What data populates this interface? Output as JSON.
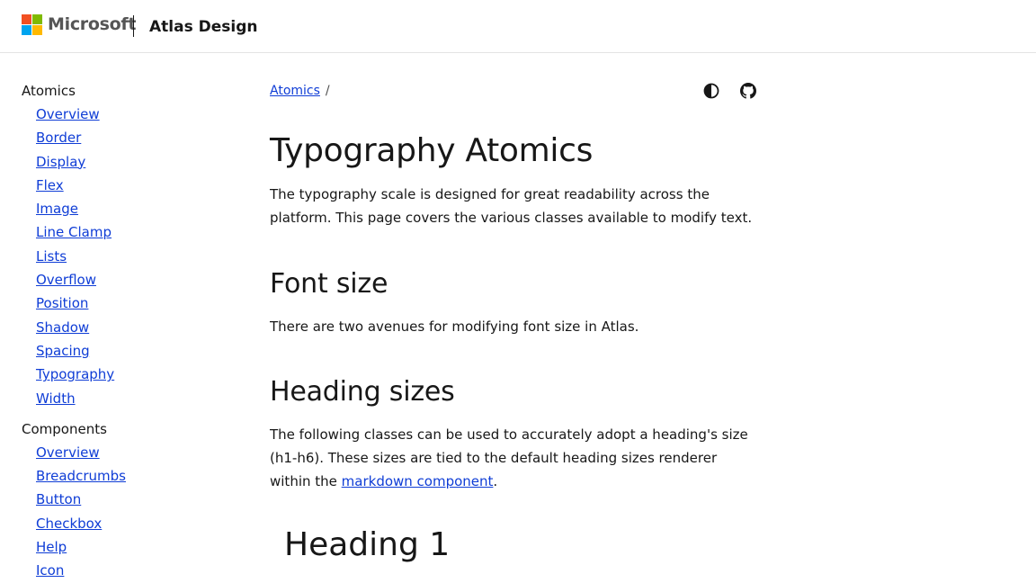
{
  "header": {
    "brand": "Microsoft",
    "site_title": "Atlas Design"
  },
  "sidebar": {
    "groups": [
      {
        "title": "Atomics",
        "items": [
          "Overview",
          "Border",
          "Display",
          "Flex",
          "Image",
          "Line Clamp",
          "Lists",
          "Overflow",
          "Position",
          "Shadow",
          "Spacing",
          "Typography",
          "Width"
        ]
      },
      {
        "title": "Components",
        "items": [
          "Overview",
          "Breadcrumbs",
          "Button",
          "Checkbox",
          "Help",
          "Icon"
        ]
      }
    ]
  },
  "breadcrumb": {
    "items": [
      "Atomics"
    ],
    "separator": "/"
  },
  "toolbar": {
    "theme_icon": "contrast-icon",
    "github_icon": "github-icon"
  },
  "main": {
    "title": "Typography Atomics",
    "intro": "The typography scale is designed for great readability across the platform. This page covers the various classes available to modify text.",
    "sections": [
      {
        "heading": "Font size",
        "text": "There are two avenues for modifying font size in Atlas."
      },
      {
        "heading": "Heading sizes",
        "text_before": "The following classes can be used to accurately adopt a heading's size (h1-h6). These sizes are tied to the default heading sizes renderer within the ",
        "link": "markdown component",
        "text_after": "."
      }
    ],
    "demo_heading": "Heading 1"
  },
  "colors": {
    "link": "#0f3dd6",
    "text": "#171717",
    "ms_red": "#f25022",
    "ms_green": "#7fba00",
    "ms_blue": "#00a4ef",
    "ms_yellow": "#ffb900"
  }
}
